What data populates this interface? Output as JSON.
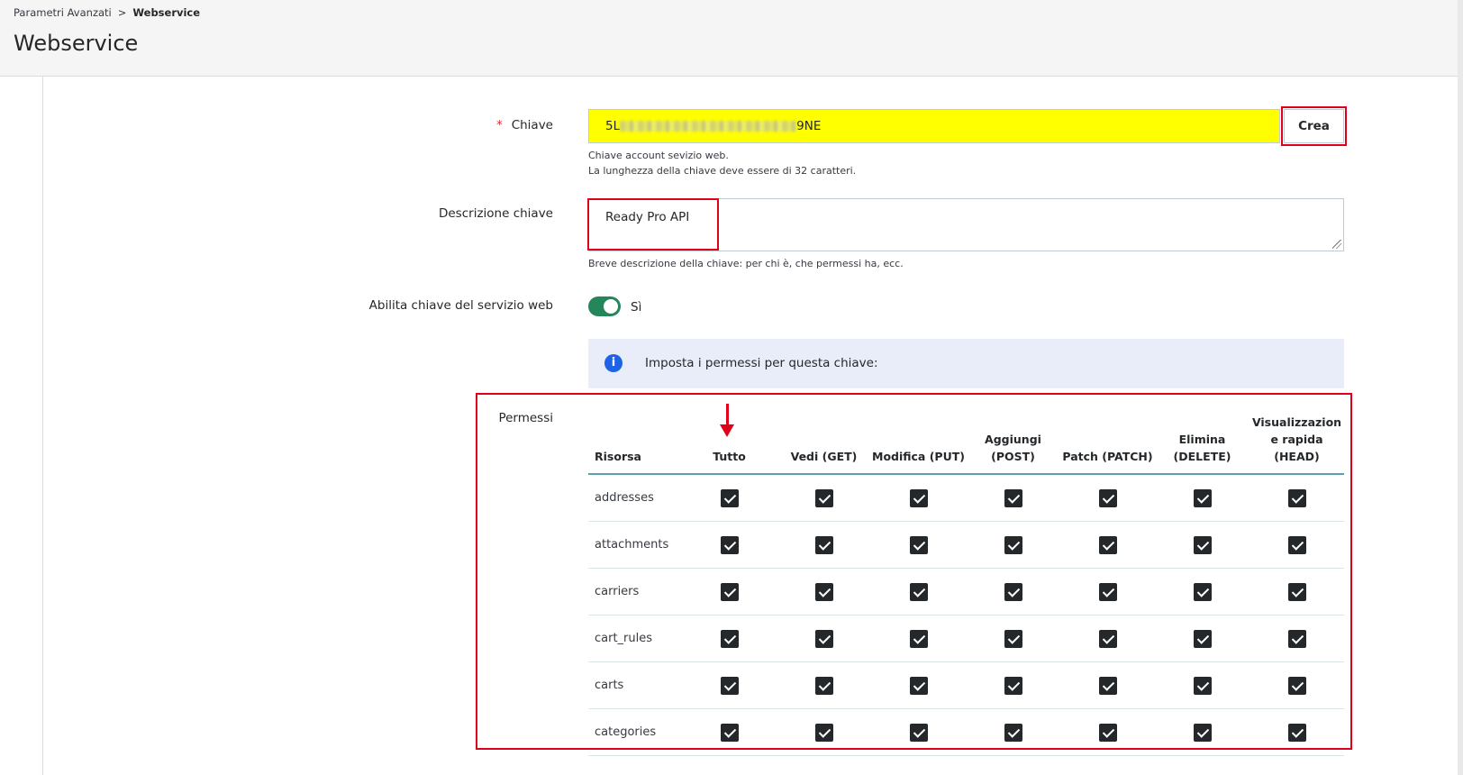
{
  "breadcrumb": {
    "parent": "Parametri Avanzati",
    "separator": ">",
    "current": "Webservice"
  },
  "page_title": "Webservice",
  "key": {
    "label": "Chiave",
    "required_mark": "*",
    "value_prefix": "5L",
    "value_suffix": "9NE",
    "generate_button": "Crea",
    "help_line1": "Chiave account sevizio web.",
    "help_line2": "La lunghezza della chiave deve essere di 32 caratteri."
  },
  "description": {
    "label": "Descrizione chiave",
    "value": "Ready Pro API",
    "help": "Breve descrizione della chiave: per chi è, che permessi ha, ecc."
  },
  "enable": {
    "label": "Abilita chiave del servizio web",
    "value_label": "Sì",
    "checked": true
  },
  "info": {
    "icon": "info-icon",
    "text": "Imposta i permessi per questa chiave:"
  },
  "permissions": {
    "label": "Permessi",
    "columns": {
      "resource": "Risorsa",
      "all": "Tutto",
      "get": "Vedi (GET)",
      "put": "Modifica (PUT)",
      "post_1": "Aggiungi",
      "post_2": "(POST)",
      "patch": "Patch (PATCH)",
      "delete_1": "Elimina",
      "delete_2": "(DELETE)",
      "head_1": "Visualizzazion",
      "head_2": "e rapida",
      "head_3": "(HEAD)"
    },
    "rows": [
      "addresses",
      "attachments",
      "carriers",
      "cart_rules",
      "carts",
      "categories"
    ],
    "all_checked": true
  },
  "colors": {
    "highlight_input": "#ffff00",
    "annotation_red": "#e0001b",
    "toggle_on": "#25865a",
    "info_bg": "#e8edf9"
  }
}
